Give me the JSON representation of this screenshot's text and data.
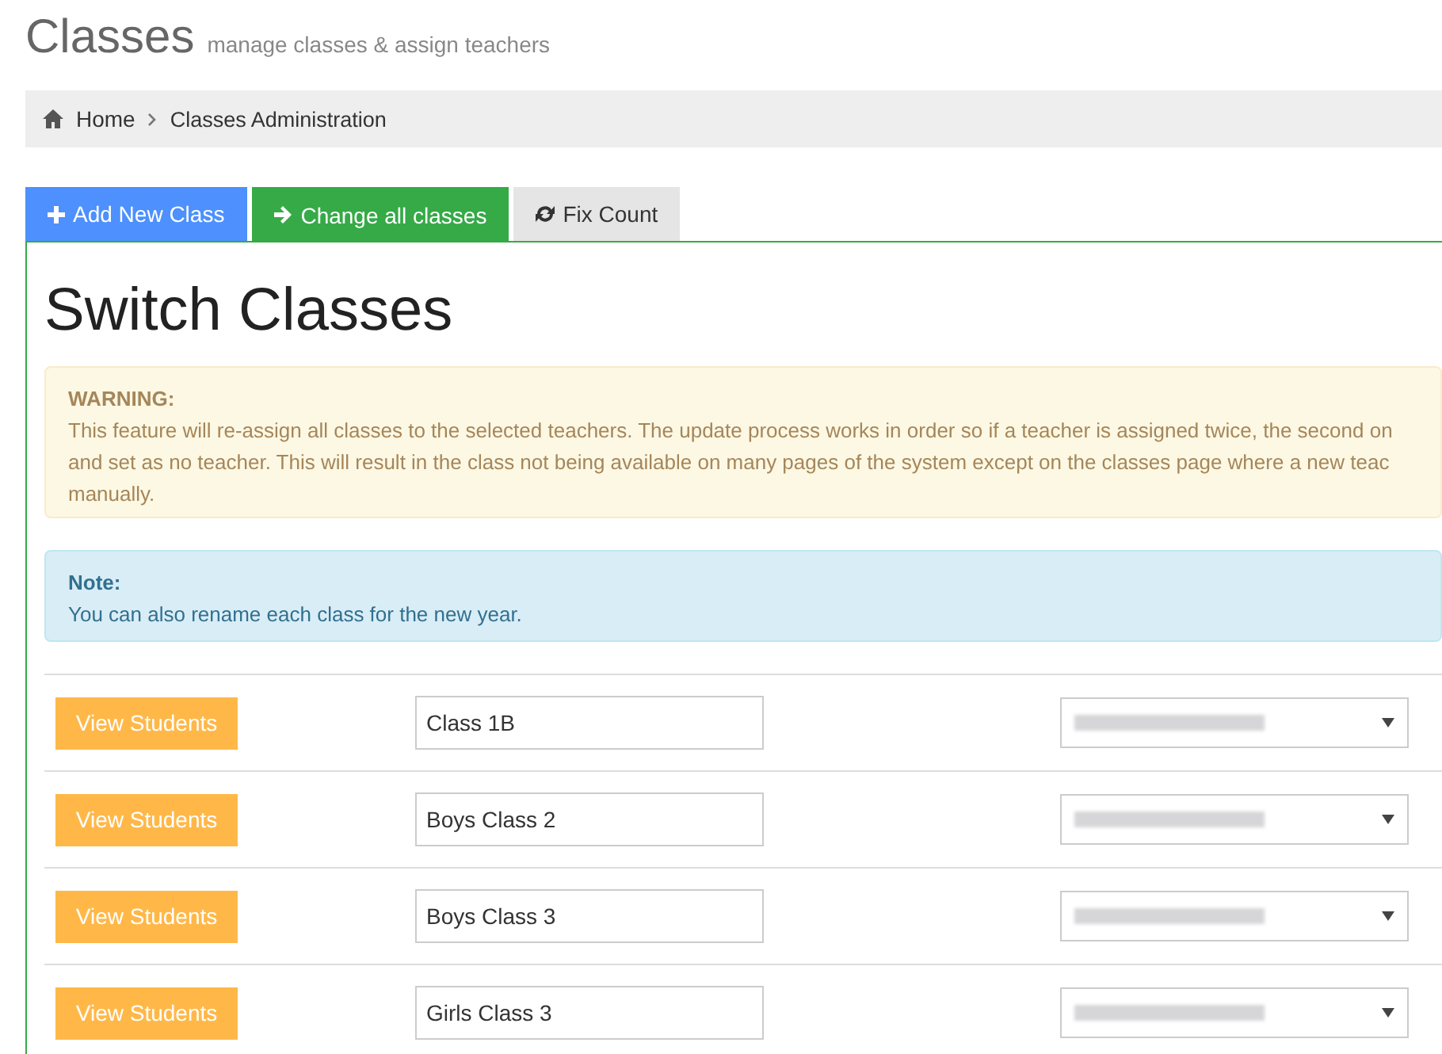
{
  "header": {
    "title": "Classes",
    "subtitle": "manage classes & assign teachers"
  },
  "breadcrumb": [
    {
      "label": "Home",
      "kind": "home"
    },
    {
      "label": "Classes Administration",
      "kind": "current"
    }
  ],
  "tabs": [
    {
      "label": "Add New Class",
      "kind": "add",
      "selected": false
    },
    {
      "label": "Change all classes",
      "kind": "change",
      "selected": true
    },
    {
      "label": "Fix Count",
      "kind": "refresh",
      "selected": false
    }
  ],
  "panel": {
    "heading": "Switch Classes",
    "warning": {
      "title": "WARNING:",
      "lines": [
        "This feature will re-assign all classes to the selected teachers. The update process works in order so if a teacher is assigned twice, the second on",
        "and set as no teacher. This will result in the class not being available on many pages of the system except on the classes page where a new teac",
        "manually."
      ]
    },
    "note": {
      "title": "Note:",
      "text": "You can also rename each class for the new year."
    },
    "rows": [
      {
        "button": "View Students",
        "class_name": "Class 1B"
      },
      {
        "button": "View Students",
        "class_name": "Boys Class 2"
      },
      {
        "button": "View Students",
        "class_name": "Boys Class 3"
      },
      {
        "button": "View Students",
        "class_name": "Girls Class 3"
      }
    ]
  }
}
